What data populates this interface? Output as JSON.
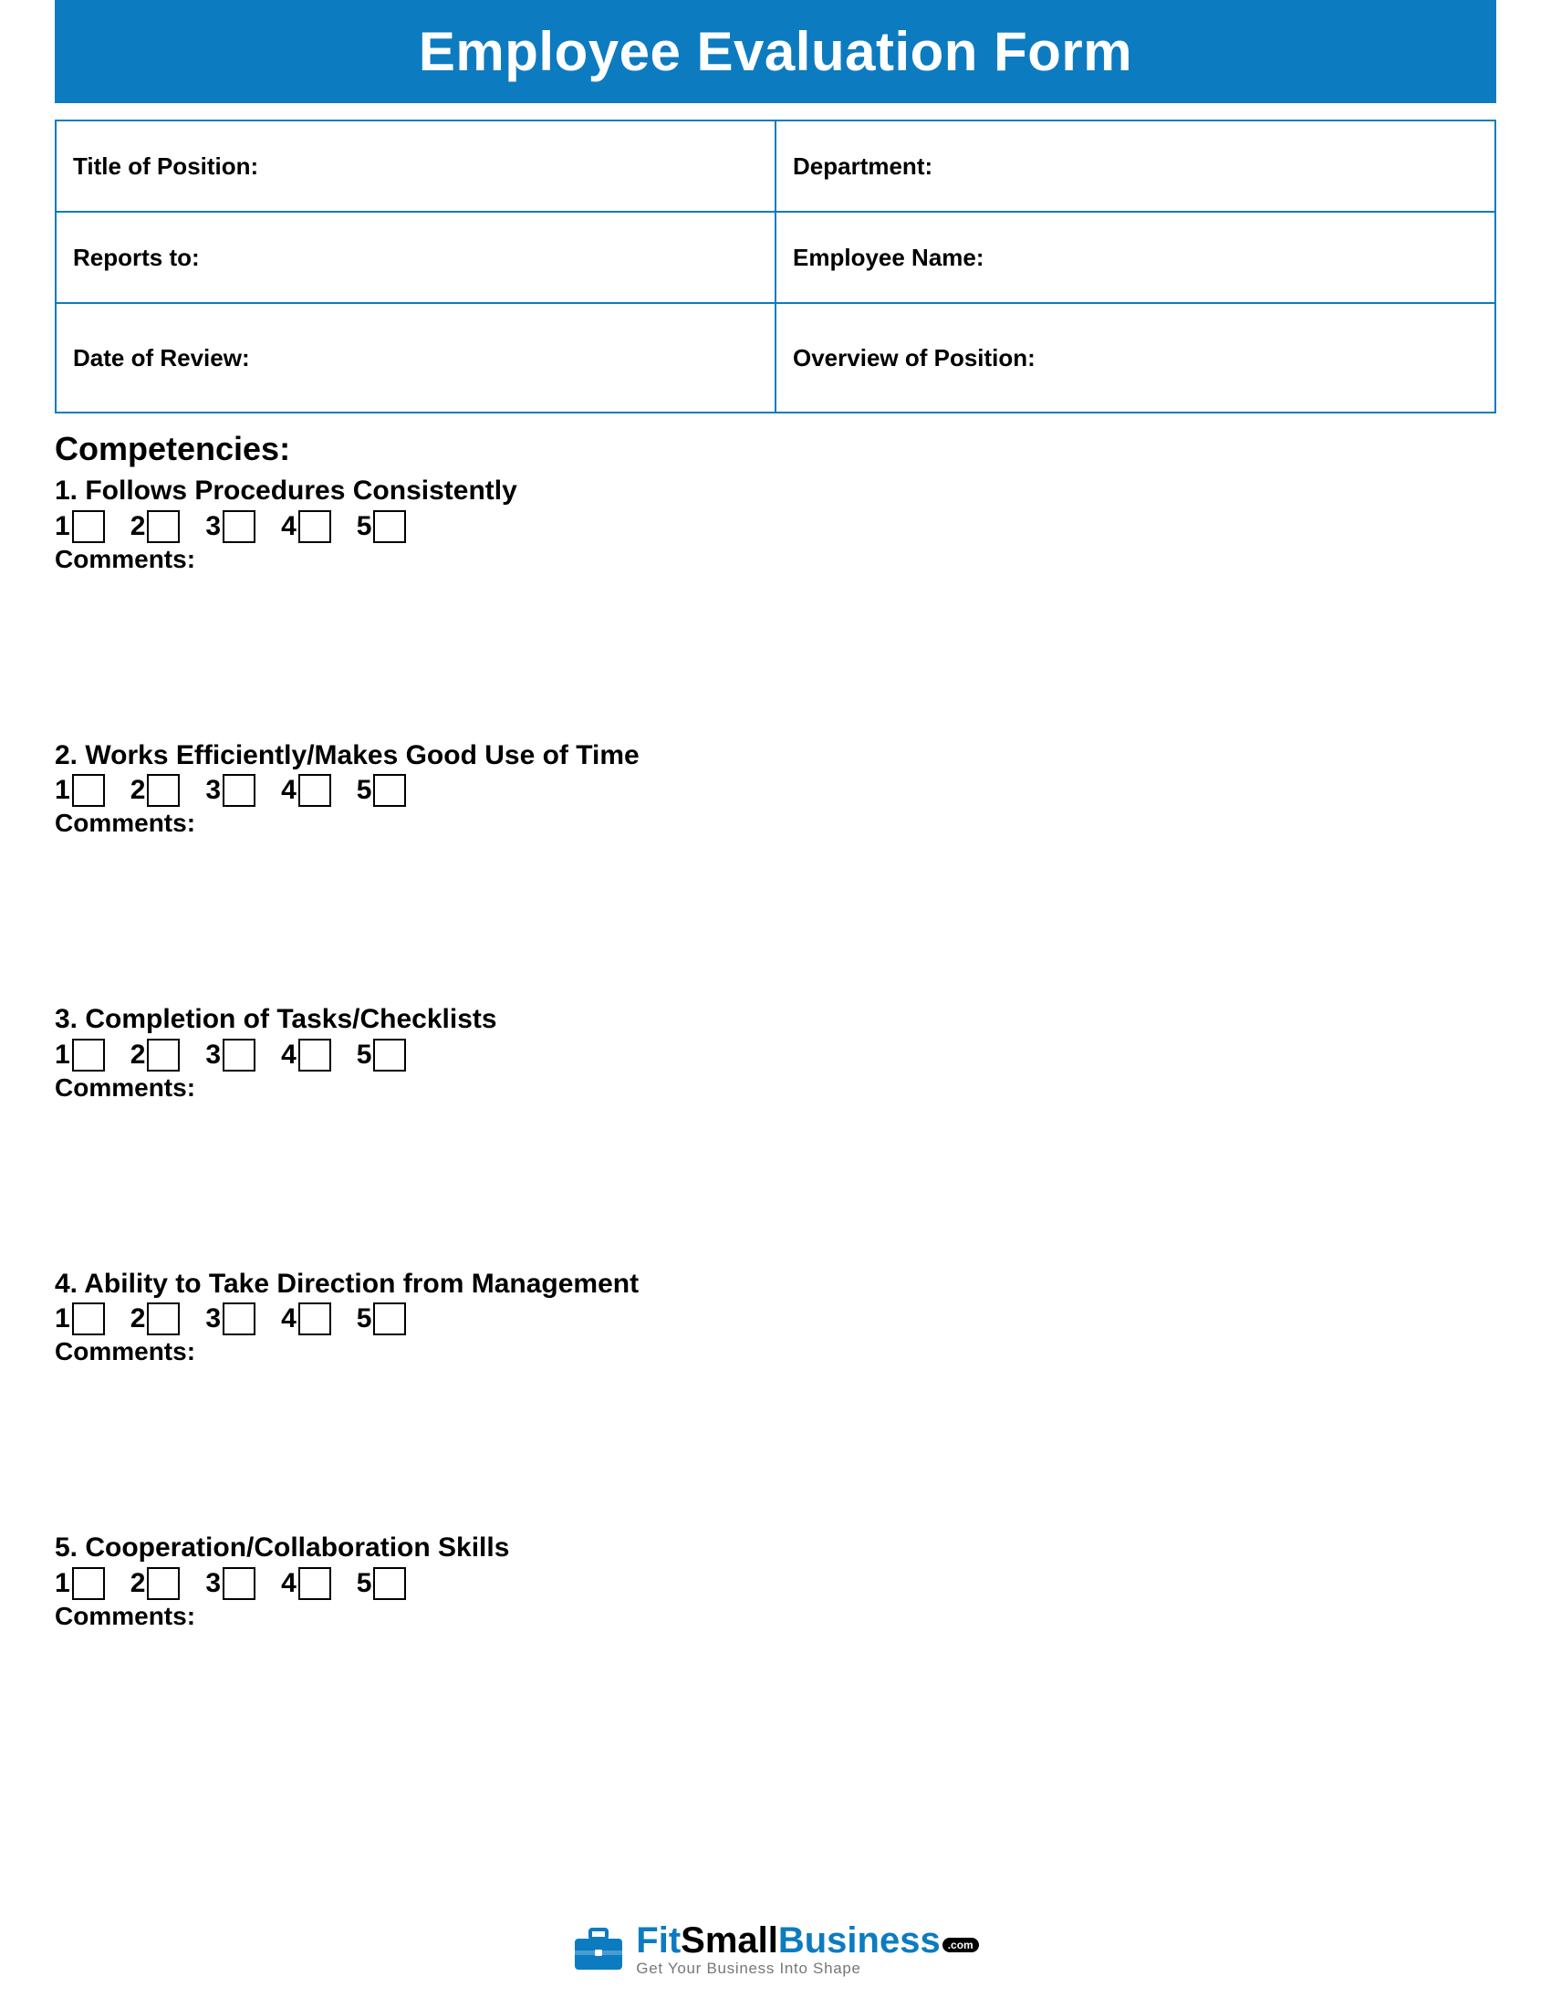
{
  "header": {
    "title": "Employee Evaluation Form"
  },
  "info": {
    "row1": {
      "cell1": "Title of Position:",
      "cell2": "Department:"
    },
    "row2": {
      "cell1": "Reports to:",
      "cell2": "Employee Name:"
    },
    "row3": {
      "cell1": "Date of Review:",
      "cell2": "Overview of Position:"
    }
  },
  "section_title": "Competencies:",
  "rating_scale": [
    "1",
    "2",
    "3",
    "4",
    "5"
  ],
  "comments_label": "Comments:",
  "competencies": [
    {
      "num": "1.",
      "title": "Follows Procedures Consistently"
    },
    {
      "num": "2.",
      "title": "Works Efficiently/Makes Good Use of Time"
    },
    {
      "num": "3.",
      "title": "Completion of Tasks/Checklists"
    },
    {
      "num": "4.",
      "title": "Ability to Take Direction from Management"
    },
    {
      "num": "5.",
      "title": "Cooperation/Collaboration Skills"
    }
  ],
  "footer": {
    "brand_fit": "Fit",
    "brand_small": "Small",
    "brand_business": "Business",
    "dotcom": ".com",
    "tagline": "Get Your Business Into Shape"
  }
}
